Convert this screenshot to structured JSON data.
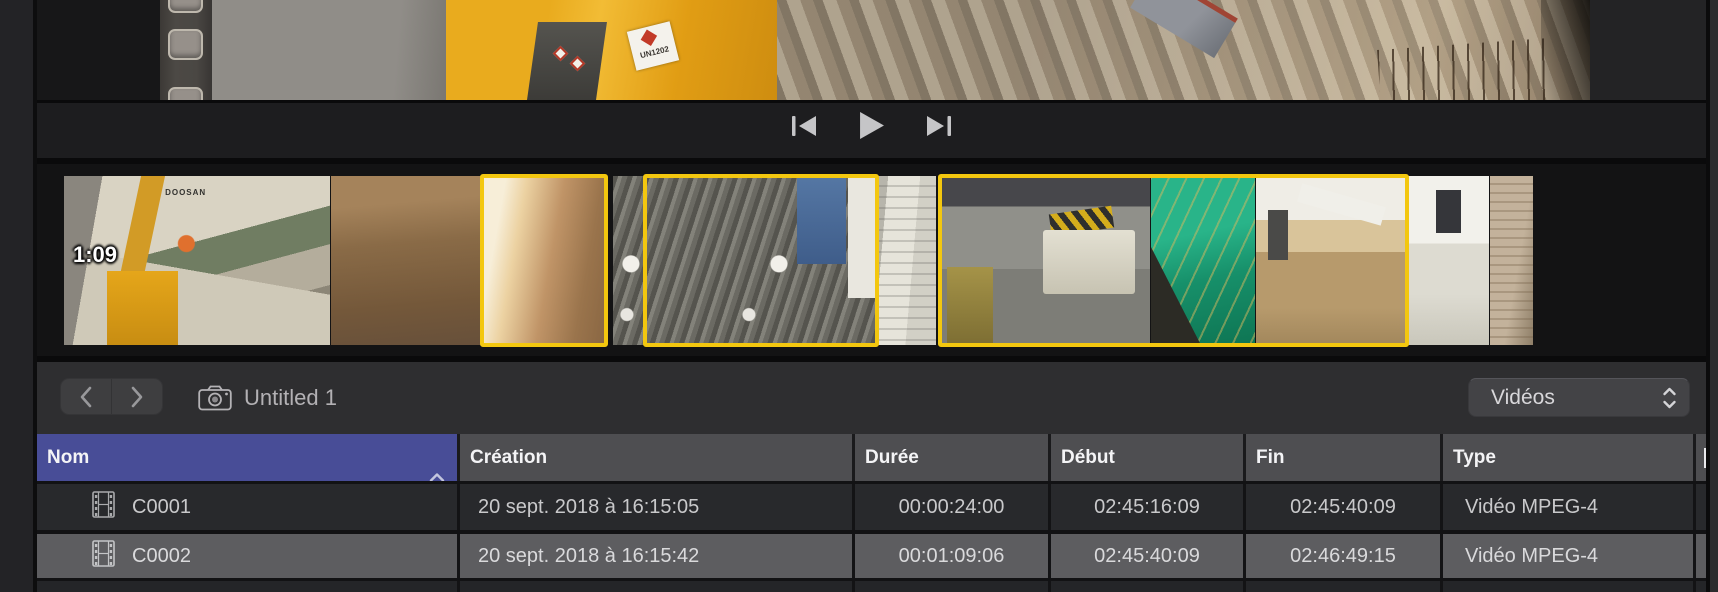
{
  "icons": {
    "skip_to_start": "⏮",
    "play": "▶",
    "skip_to_end": "⏭",
    "nav_back": "‹",
    "nav_forward": "›",
    "camera": "📷",
    "film_clip": "🎞",
    "sort_ascending": "ᐱ",
    "popup_up_down": "⌃⌄"
  },
  "colors": {
    "selection_yellow": "#f3c70f",
    "sorted_header_blue": "#484d97",
    "header_gray": "#4e4e51",
    "row_dark": "#28292c",
    "row_light": "#5d5d60"
  },
  "preview": {
    "photo_labels": {
      "hazard_plate": "UN1202"
    }
  },
  "filmstrip": {
    "duration_badge": "1:09",
    "thumb_labels": {
      "machine_brand": "DOOSAN"
    }
  },
  "toolbar": {
    "event_title": "Untitled 1",
    "filter_dropdown": {
      "value": "Vidéos"
    }
  },
  "table": {
    "sort_column": "Nom",
    "columns": [
      {
        "label": "Nom"
      },
      {
        "label": "Création"
      },
      {
        "label": "Durée"
      },
      {
        "label": "Début"
      },
      {
        "label": "Fin"
      },
      {
        "label": "Type"
      }
    ],
    "rows": [
      {
        "nom": "C0001",
        "creation": "20 sept. 2018 à 16:15:05",
        "duree": "00:00:24:00",
        "debut": "02:45:16:09",
        "fin": "02:45:40:09",
        "type": "Vidéo MPEG-4"
      },
      {
        "nom": "C0002",
        "creation": "20 sept. 2018 à 16:15:42",
        "duree": "00:01:09:06",
        "debut": "02:45:40:09",
        "fin": "02:46:49:15",
        "type": "Vidéo MPEG-4"
      }
    ]
  }
}
